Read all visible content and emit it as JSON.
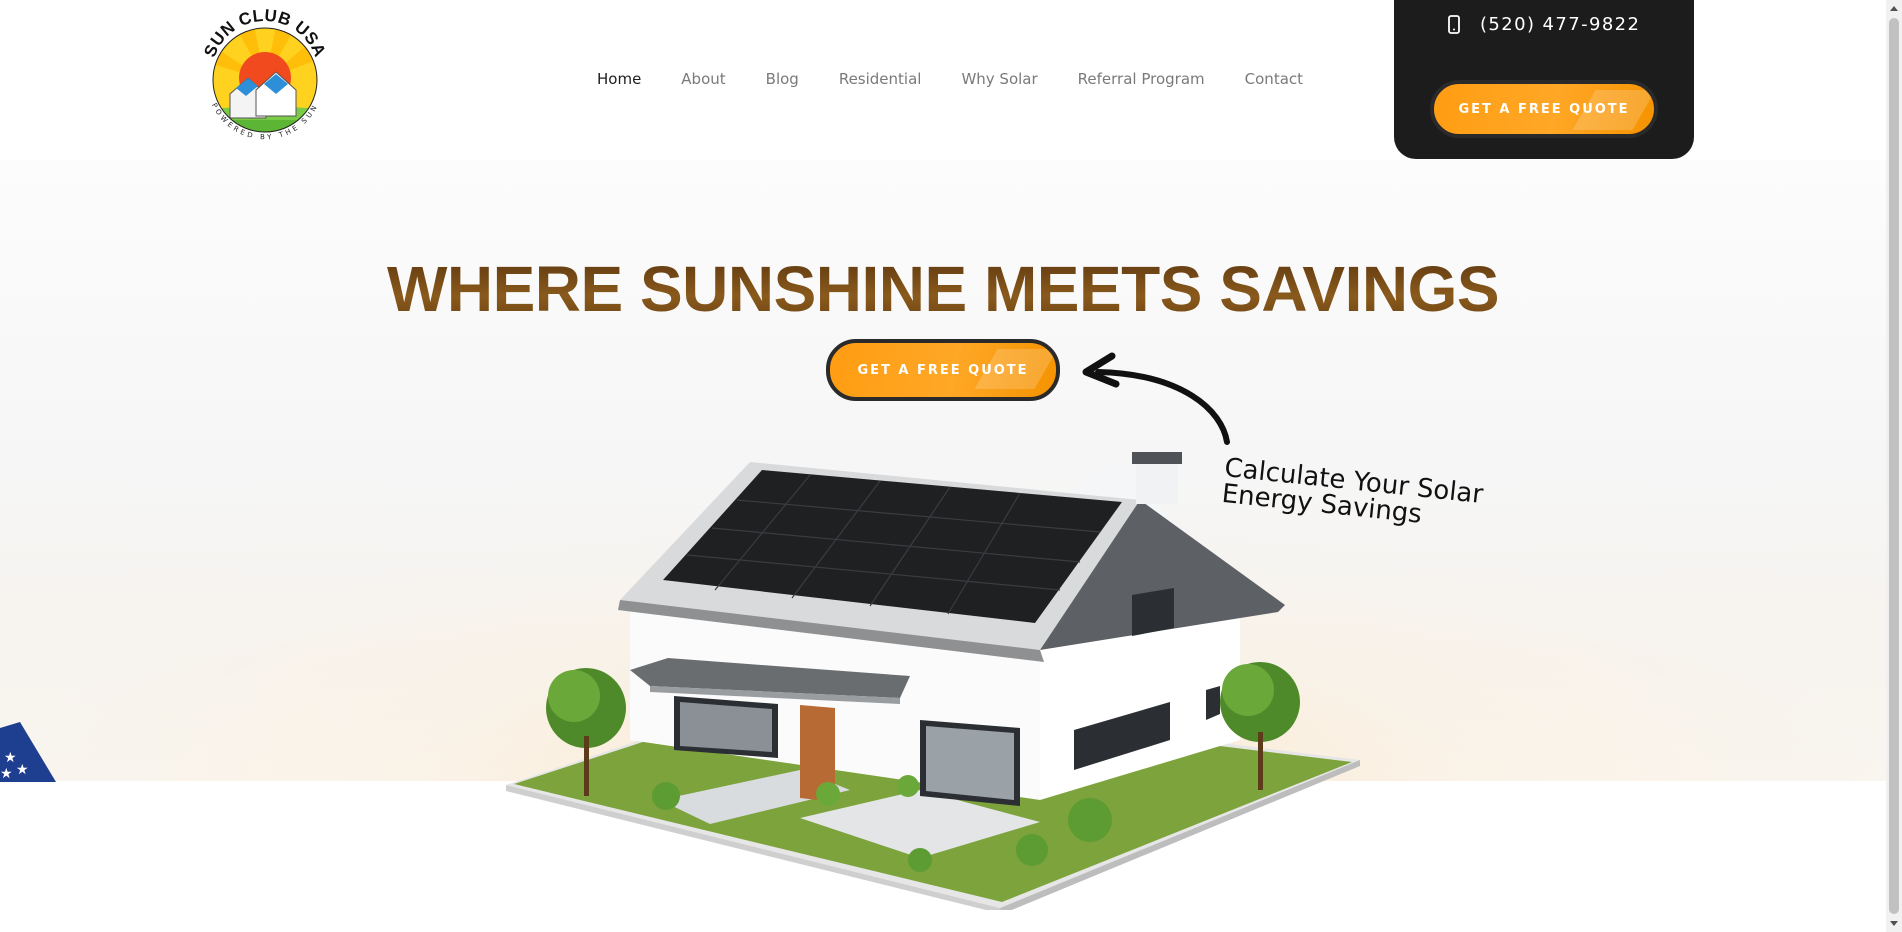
{
  "header": {
    "logo": {
      "text_top": "SUN CLUB USA",
      "text_bottom": "POWERED BY THE SUN"
    },
    "nav": [
      {
        "label": "Home",
        "active": true
      },
      {
        "label": "About",
        "active": false
      },
      {
        "label": "Blog",
        "active": false
      },
      {
        "label": "Residential",
        "active": false
      },
      {
        "label": "Why Solar",
        "active": false
      },
      {
        "label": "Referral Program",
        "active": false
      },
      {
        "label": "Contact",
        "active": false
      }
    ],
    "phone": "(520) 477-9822",
    "phone_icon": "mobile-phone-icon",
    "quote_label": "GET A FREE QUOTE"
  },
  "hero": {
    "title": "WHERE SUNSHINE MEETS SAVINGS",
    "quote_label": "GET A FREE QUOTE",
    "annotation_line1": "Calculate Your Solar",
    "annotation_line2": "Energy Savings"
  },
  "colors": {
    "accent_orange": "#ffa01a",
    "title_brown": "#6b4214",
    "panel_dark": "#1c1c1c"
  }
}
